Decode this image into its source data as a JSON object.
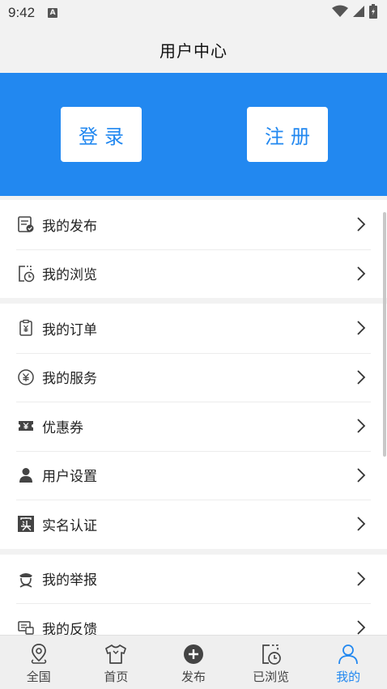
{
  "status_bar": {
    "time": "9:42",
    "notification_badge": "A"
  },
  "header": {
    "title": "用户中心"
  },
  "auth": {
    "login_label": "登录",
    "register_label": "注册"
  },
  "groups": [
    {
      "items": [
        {
          "label": "我的发布",
          "icon": "post-icon"
        },
        {
          "label": "我的浏览",
          "icon": "history-icon"
        }
      ]
    },
    {
      "items": [
        {
          "label": "我的订单",
          "icon": "order-icon"
        },
        {
          "label": "我的服务",
          "icon": "yen-circle-icon"
        },
        {
          "label": "优惠券",
          "icon": "coupon-icon"
        },
        {
          "label": "用户设置",
          "icon": "user-icon"
        },
        {
          "label": "实名认证",
          "icon": "verify-icon"
        }
      ]
    },
    {
      "items": [
        {
          "label": "我的举报",
          "icon": "police-icon"
        },
        {
          "label": "我的反馈",
          "icon": "feedback-icon"
        }
      ]
    }
  ],
  "tabbar": {
    "tabs": [
      {
        "label": "全国",
        "icon": "location-icon"
      },
      {
        "label": "首页",
        "icon": "shirt-icon"
      },
      {
        "label": "发布",
        "icon": "plus-circle-icon"
      },
      {
        "label": "已浏览",
        "icon": "history-icon"
      },
      {
        "label": "我的",
        "icon": "user-outline-icon",
        "active": true
      }
    ]
  },
  "colors": {
    "accent": "#2288f0",
    "background": "#f2f2f2"
  }
}
